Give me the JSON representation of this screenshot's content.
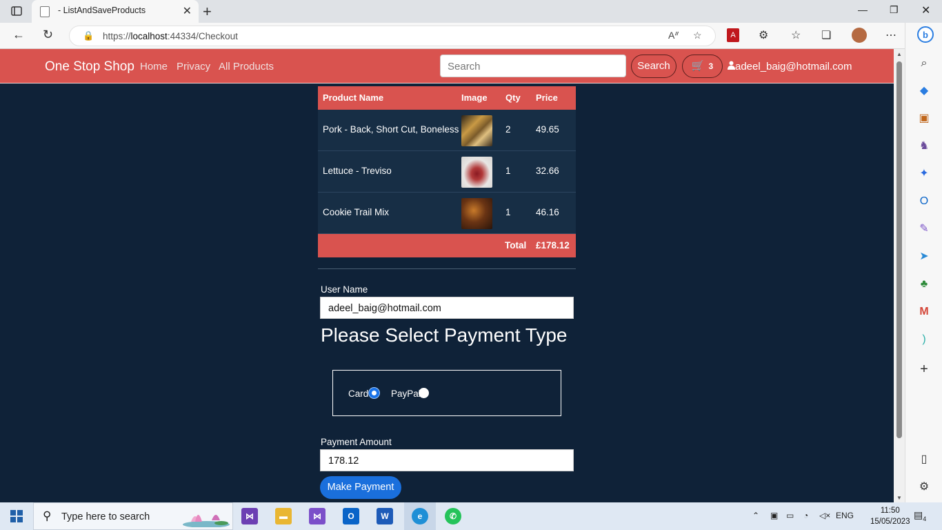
{
  "browser": {
    "tab_title": "- ListAndSaveProducts",
    "url_prefix": "https://",
    "url_host": "localhost",
    "url_rest": ":44334/Checkout"
  },
  "site": {
    "brand": "One Stop Shop",
    "nav": [
      "Home",
      "Privacy",
      "All Products"
    ],
    "search_placeholder": "Search",
    "search_button": "Search",
    "cart_count": "3",
    "user": "adeel_baig@hotmail.com"
  },
  "table": {
    "headers": [
      "Product Name",
      "Image",
      "Qty",
      "Price"
    ],
    "rows": [
      {
        "name": "Pork - Back, Short Cut, Boneless",
        "qty": "2",
        "price": "49.65",
        "image": "pork-image"
      },
      {
        "name": "Lettuce - Treviso",
        "qty": "1",
        "price": "32.66",
        "image": "lettuce-image"
      },
      {
        "name": "Cookie Trail Mix",
        "qty": "1",
        "price": "46.16",
        "image": "cookie-image"
      }
    ],
    "total_label": "Total",
    "total_value": "£178.12"
  },
  "form": {
    "username_label": "User Name",
    "username_value": "adeel_baig@hotmail.com",
    "heading": "Please Select Payment Type",
    "options": [
      {
        "label": "Card",
        "selected": true
      },
      {
        "label": "PayPal",
        "selected": false
      }
    ],
    "amount_label": "Payment Amount",
    "amount_value": "178.12",
    "submit": "Make Payment"
  },
  "taskbar": {
    "search_placeholder": "Type here to search",
    "lang": "ENG",
    "time": "11:50",
    "date": "15/05/2023",
    "notifications": "4"
  },
  "colors": {
    "navbar": "#d9534f",
    "page_bg": "#0f2238",
    "button": "#1a6fdc"
  }
}
